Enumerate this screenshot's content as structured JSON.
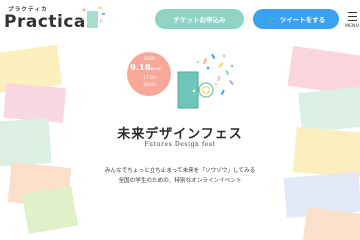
{
  "brand": {
    "kana": "プラクティカ",
    "name": "Practica"
  },
  "header": {
    "ticket_label": "チケットお申込み",
    "tweet_label": "ツイートをする",
    "menu_label": "MENU"
  },
  "event": {
    "year": "2020",
    "date": "9.18",
    "weekday": "(Fri)",
    "time_start": "17:00-",
    "time_end": "20:00",
    "title_jp": "未来デザインフェス",
    "title_en": "Futures Design fest",
    "desc_line1": "みんなでちょっと立ち止まって未来を「ソウゾウ」してみる",
    "desc_line2": "全国の学生のための、特別なオンラインイベント"
  },
  "colors": {
    "ticket_button": "#8fd3c4",
    "tweet_button": "#3aa1f0",
    "date_badge": "#f7a89a",
    "door": "#6fc6b8"
  }
}
